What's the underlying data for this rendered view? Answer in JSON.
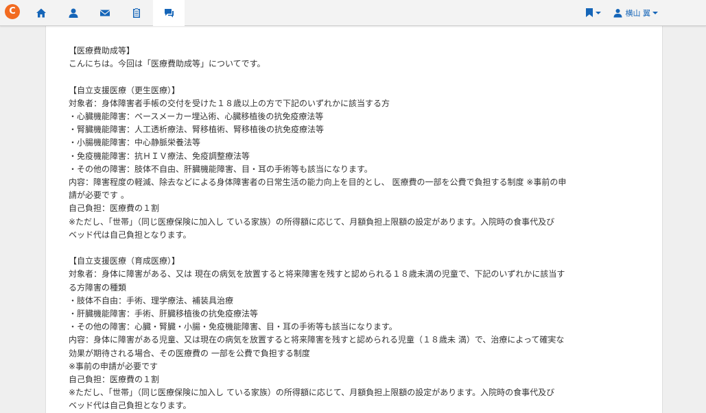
{
  "header": {
    "logo_letter": "C",
    "nav": [
      "home-icon",
      "user-icon",
      "mail-icon",
      "clipboard-icon",
      "chat-icon"
    ],
    "active_nav": "chat-icon",
    "user_name": "横山 翼",
    "accent": "#1565b8"
  },
  "article": {
    "lines": [
      "【医療費助成等】",
      "こんにちは。今回は「医療費助成等」についてです。",
      "",
      "【自立支援医療（更生医療）】",
      "対象者：身体障害者手帳の交付を受けた１８歳以上の方で下記のいずれかに該当する方",
      "・心臓機能障害：ペースメーカー埋込術、心臓移植後の抗免疫療法等",
      "・腎臓機能障害：人工透析療法、腎移植術、腎移植後の抗免疫療法等",
      "・小腸機能障害：中心静脈栄養法等",
      "・免疫機能障害：抗ＨＩＶ療法、免疫調整療法等",
      "・その他の障害：肢体不自由、肝臓機能障害、目・耳の手術等も該当になります。",
      "内容：障害程度の軽減、除去などによる身体障害者の日常生活の能力向上を目的とし、 医療費の一部を公費で負担する制度 ※事前の申",
      "請が必要です 。",
      "自己負担：医療費の１割",
      "※ただし、「世帯」（同じ医療保険に加入し ている家族）の所得額に応じて、月額負担上限額の設定があります。入院時の食事代及び",
      "ベッド代は自己負担となります。",
      "",
      "【自立支援医療（育成医療）】",
      "対象者：身体に障害がある、又は 現在の病気を放置すると将来障害を残すと認められる１８歳未満の児童で、下記のいずれかに該当す",
      "る方障害の種類",
      "・肢体不自由：手術、理学療法、補装具治療",
      "・肝臓機能障害：手術、肝臓移植後の抗免疫療法等",
      "・その他の障害：心臓・腎臓・小腸・免疫機能障害、目・耳の手術等も該当になります。",
      "内容：身体に障害がある児童、又は現在の病気を放置すると将来障害を残すと認められる児童（１８歳未 満）で、治療によって確実な",
      "効果が期待される場合、その医療費の 一部を公費で負担する制度",
      "※事前の申請が必要です",
      "自己負担：医療費の１割",
      "※ただし、「世帯」（同じ医療保険に加入し ている家族）の所得額に応じて、月額負担上限額の設定があります。入院時の食事代及び",
      "ベッド代は自己負担となります。"
    ]
  }
}
